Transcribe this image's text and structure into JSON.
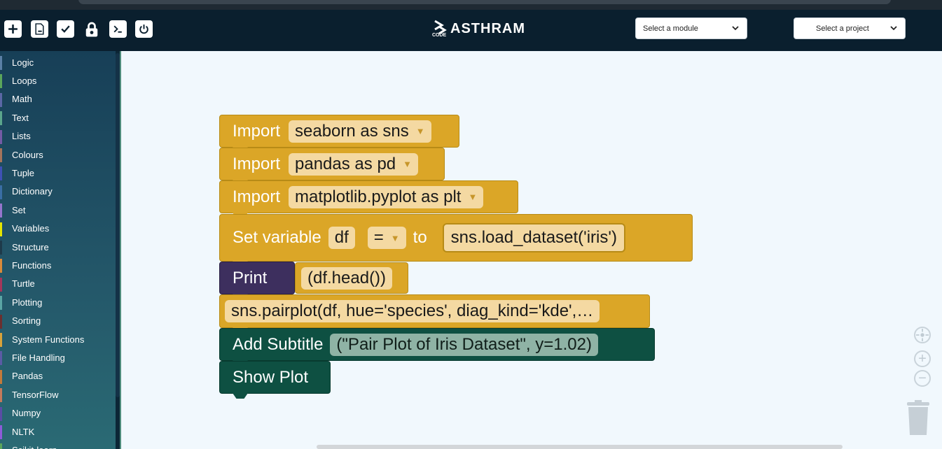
{
  "topbar": {
    "toolbar": [
      {
        "name": "new-file-icon"
      },
      {
        "name": "remove-file-icon"
      },
      {
        "name": "checkbox-icon"
      },
      {
        "name": "lock-icon"
      },
      {
        "name": "terminal-icon"
      },
      {
        "name": "power-icon"
      }
    ],
    "logo": {
      "text": "ASTHRAM",
      "subtext": "CODE"
    },
    "module_select": "Select a module",
    "project_select": "Select a project"
  },
  "sidebar": {
    "categories": [
      {
        "label": "Logic",
        "color": "#5b80a5"
      },
      {
        "label": "Loops",
        "color": "#5ba55b"
      },
      {
        "label": "Math",
        "color": "#5b67a5"
      },
      {
        "label": "Text",
        "color": "#5ba58c"
      },
      {
        "label": "Lists",
        "color": "#745ba5"
      },
      {
        "label": "Colours",
        "color": "#a5745b"
      },
      {
        "label": "Tuple",
        "color": "#3f51b5"
      },
      {
        "label": "Dictionary",
        "color": "#3a6ea5"
      },
      {
        "label": "Set",
        "color": "#9575cd"
      },
      {
        "label": "Variables",
        "color": "#e5e500"
      },
      {
        "label": "Structure",
        "color": "#1e3a4a"
      },
      {
        "label": "Functions",
        "color": "#d98a3a"
      },
      {
        "label": "Turtle",
        "color": "#a5365b"
      },
      {
        "label": "Plotting",
        "color": "#5ba5a5"
      },
      {
        "label": "Sorting",
        "color": "#6b2f2f"
      },
      {
        "label": "System Functions",
        "color": "#d9a23a"
      },
      {
        "label": "File Handling",
        "color": "#5b5ba5"
      },
      {
        "label": "Pandas",
        "color": "#c47a3a"
      },
      {
        "label": "TensorFlow",
        "color": "#c47a5b"
      },
      {
        "label": "Numpy",
        "color": "#5b4ca5"
      },
      {
        "label": "NLTK",
        "color": "#8e5bd9"
      },
      {
        "label": "Scikit-learn",
        "color": "#5ba55b"
      }
    ]
  },
  "blocks": {
    "import1": {
      "keyword": "Import",
      "value": "seaborn as sns"
    },
    "import2": {
      "keyword": "Import",
      "value": "pandas as pd"
    },
    "import3": {
      "keyword": "Import",
      "value": "matplotlib.pyplot as plt"
    },
    "setvar": {
      "keyword": "Set variable",
      "var": "df",
      "op": "=",
      "to": "to",
      "value": "sns.load_dataset('iris')"
    },
    "print": {
      "keyword": "Print",
      "value": "(df.head())"
    },
    "pairplot": {
      "value": "sns.pairplot(df, hue='species', diag_kind='kde',…"
    },
    "subtitle": {
      "keyword": "Add Subtitle",
      "value": "(\"Pair Plot of Iris Dataset\", y=1.02)"
    },
    "show": {
      "keyword": "Show Plot"
    }
  },
  "colors": {
    "topbar": "#0a1f2e",
    "block_gold": "#dba627",
    "block_purple": "#3d2f5e",
    "block_green": "#0e5042",
    "workspace": "#f1f8fd"
  }
}
